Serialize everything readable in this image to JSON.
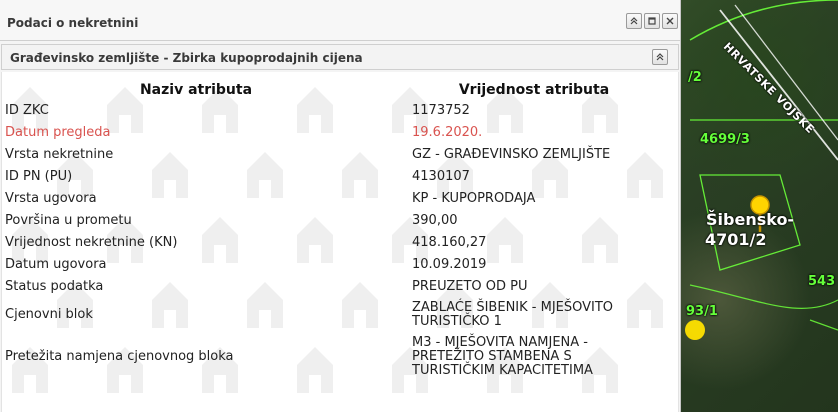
{
  "map": {
    "road_label": "HRVATSKE VOJSKE",
    "labels": [
      {
        "text": "4699/3",
        "color": "green"
      },
      {
        "text": "/2",
        "color": "green"
      },
      {
        "text": "4701/2",
        "color": "white"
      },
      {
        "text": "Šibensko-",
        "color": "white"
      },
      {
        "text": "93/1",
        "color": "green"
      },
      {
        "text": "543",
        "color": "green"
      }
    ]
  },
  "panel": {
    "title": "Podaci o nekretnini",
    "tools": {
      "collapse_icon": "double-chevron-up",
      "maximize_icon": "window",
      "close_icon": "x"
    }
  },
  "section": {
    "title": "Građevinsko zemljište - Zbirka kupoprodajnih cijena",
    "collapse_icon": "double-chevron-up"
  },
  "table": {
    "headers": {
      "attribute": "Naziv atributa",
      "value": "Vrijednost atributa"
    },
    "rows": [
      {
        "label": "ID ZKC",
        "value": "1173752"
      },
      {
        "label": "Datum pregleda",
        "value": "19.6.2020."
      },
      {
        "label": "Vrsta nekretnine",
        "value": "GZ - GRAĐEVINSKO ZEMLJIŠTE"
      },
      {
        "label": "ID PN (PU)",
        "value": "4130107"
      },
      {
        "label": "Vrsta ugovora",
        "value": "KP - KUPOPRODAJA"
      },
      {
        "label": "Površina u prometu",
        "value": "390,00"
      },
      {
        "label": "Vrijednost nekretnine (KN)",
        "value": "418.160,27"
      },
      {
        "label": "Datum ugovora",
        "value": "10.09.2019"
      },
      {
        "label": "Status podatka",
        "value": "PREUZETO OD PU"
      },
      {
        "label": "Cjenovni blok",
        "value": "ZABLAĆE ŠIBENIK - MJEŠOVITO\nTURISTIČKO 1"
      },
      {
        "label": "Pretežita namjena cjenovnog bloka",
        "value": "M3 - MJEŠOVITA NAMJENA -\nPRETEŽITO STAMBENA S\nTURISTIČKIM KAPACITETIMA"
      }
    ],
    "highlight_color": "#d9534f"
  }
}
